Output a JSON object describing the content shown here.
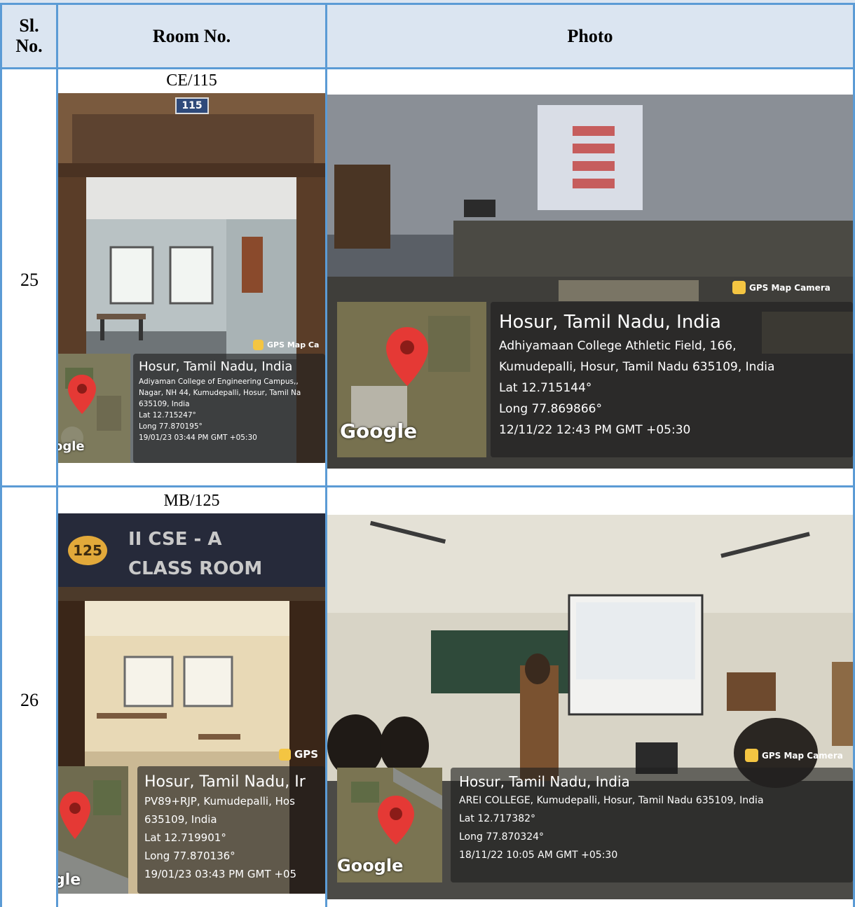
{
  "table": {
    "headers": {
      "sl_no": "Sl.\nNo.",
      "room_no": "Room No.",
      "photo": "Photo"
    },
    "rows": [
      {
        "sl_no": "25",
        "room_no": "CE/115",
        "door_plate": "115",
        "door_photo": {
          "gps_label": "GPS Map Ca",
          "map_brand": "ogle",
          "title": "Hosur, Tamil Nadu, India",
          "lines": [
            "Adiyaman College of Engineering Campus,,",
            "Nagar, NH 44, Kumudepalli, Hosur, Tamil Na",
            "635109, India",
            "Lat 12.715247°",
            "Long 77.870195°",
            "19/01/23 03:44 PM GMT +05:30"
          ]
        },
        "room_photo": {
          "gps_label": "GPS Map Camera",
          "map_brand": "Google",
          "title": "Hosur, Tamil Nadu, India",
          "lines": [
            "Adhiyamaan College Athletic Field, 166,",
            "Kumudepalli, Hosur, Tamil Nadu 635109, India",
            "Lat 12.715144°",
            "Long 77.869866°",
            "12/11/22 12:43 PM GMT +05:30"
          ]
        }
      },
      {
        "sl_no": "26",
        "room_no": "MB/125",
        "door_plate": "125",
        "door_sign_line1": "II CSE - A",
        "door_sign_line2": "CLASS ROOM",
        "door_photo": {
          "gps_label": "GPS",
          "map_brand": "gle",
          "title": "Hosur, Tamil Nadu, Ir",
          "lines": [
            "PV89+RJP, Kumudepalli, Hos",
            "635109, India",
            "Lat 12.719901°",
            "Long 77.870136°",
            "19/01/23 03:43 PM GMT +05"
          ]
        },
        "room_photo": {
          "gps_label": "GPS Map Camera",
          "map_brand": "Google",
          "title": "Hosur, Tamil Nadu, India",
          "lines": [
            "AREI COLLEGE, Kumudepalli, Hosur, Tamil Nadu 635109, India",
            "Lat 12.717382°",
            "Long 77.870324°",
            "18/11/22 10:05 AM GMT +05:30"
          ]
        }
      }
    ]
  },
  "colors": {
    "border": "#5b9bd5",
    "header_bg": "#dbe5f1",
    "pin": "#e53935",
    "gps_icon": "#f4c542"
  }
}
